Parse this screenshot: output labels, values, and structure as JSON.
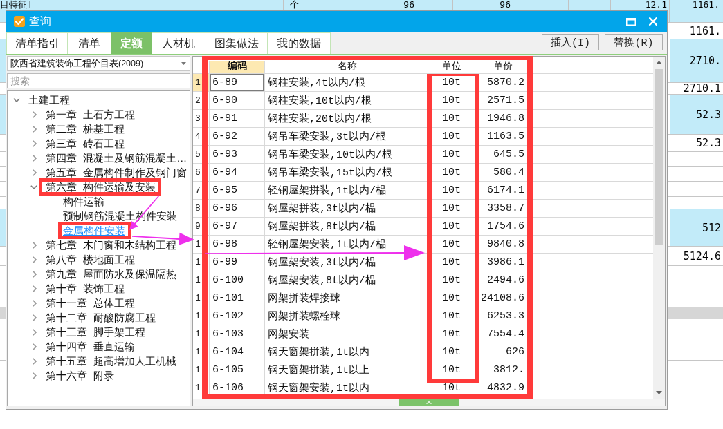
{
  "sheet": {
    "top_row": {
      "highlighted": true,
      "cells": [
        "目特征]",
        "个",
        "96",
        "96",
        "12.1",
        "1161."
      ]
    },
    "rows": [
      {
        "value": "1161.",
        "highlighted": false
      },
      {
        "value": "2710.",
        "highlighted": true
      },
      {
        "value": "2710.1",
        "highlighted": false
      },
      {
        "value": "52.3",
        "highlighted": true
      },
      {
        "value": "52.3",
        "highlighted": false
      },
      {
        "highlighted": false
      },
      {
        "highlighted": false
      },
      {
        "highlighted": false
      },
      {
        "highlighted": false
      },
      {
        "value": "512",
        "highlighted": true
      },
      {
        "value": "5124.6",
        "highlighted": false
      },
      {
        "highlighted": false
      }
    ]
  },
  "window": {
    "title": "查询",
    "tabs": [
      {
        "label": "清单指引",
        "selected": false
      },
      {
        "label": "清单",
        "selected": false
      },
      {
        "label": "定额",
        "selected": true
      },
      {
        "label": "人材机",
        "selected": false
      },
      {
        "label": "图集做法",
        "selected": false
      },
      {
        "label": "我的数据",
        "selected": false
      }
    ],
    "buttons": [
      "插入(I)",
      "替换(R)"
    ]
  },
  "catalog": {
    "dropdown": "陕西省建筑装饰工程价目表(2009)",
    "search": {
      "placeholder": "搜索"
    },
    "tree": [
      {
        "label": "土建工程",
        "expanded": true,
        "selected": false,
        "children": [
          {
            "label": "第一章 土石方工程",
            "expanded": false,
            "selected": false
          },
          {
            "label": "第二章 桩基工程",
            "expanded": false,
            "selected": false
          },
          {
            "label": "第三章 砖石工程",
            "expanded": false,
            "selected": false
          },
          {
            "label": "第四章 混凝土及钢筋混凝土…",
            "expanded": false,
            "selected": false
          },
          {
            "label": "第五章 金属构件制作及钢门窗",
            "expanded": false,
            "selected": false
          },
          {
            "label": "第六章 构件运输及安装",
            "expanded": true,
            "selected": false,
            "children": [
              {
                "label": "构件运输",
                "selected": false
              },
              {
                "label": "预制钢筋混凝土构件安装",
                "selected": false
              },
              {
                "label": "金属构件安装",
                "selected": true
              }
            ]
          },
          {
            "label": "第七章 木门窗和木结构工程",
            "expanded": false,
            "selected": false
          },
          {
            "label": "第八章 楼地面工程",
            "expanded": false,
            "selected": false
          },
          {
            "label": "第九章 屋面防水及保温隔热",
            "expanded": false,
            "selected": false
          },
          {
            "label": "第十章 装饰工程",
            "expanded": false,
            "selected": false
          },
          {
            "label": "第十一章 总体工程",
            "expanded": false,
            "selected": false
          },
          {
            "label": "第十二章 耐酸防腐工程",
            "expanded": false,
            "selected": false
          },
          {
            "label": "第十三章 脚手架工程",
            "expanded": false,
            "selected": false
          },
          {
            "label": "第十四章 垂直运输",
            "expanded": false,
            "selected": false
          },
          {
            "label": "第十五章 超高增加人工机械",
            "expanded": false,
            "selected": false
          },
          {
            "label": "第十六章 附录",
            "expanded": false,
            "selected": false
          }
        ]
      }
    ]
  },
  "table": {
    "columns": [
      {
        "label": "编码",
        "selected": true
      },
      {
        "label": "名称",
        "selected": false
      },
      {
        "label": "单位",
        "selected": false
      },
      {
        "label": "单价",
        "selected": false
      }
    ],
    "rows": [
      {
        "number": "1",
        "code": "6-89",
        "name": "钢柱安装,4t以内/根",
        "unit": "10t",
        "price": "5870.2",
        "selected": true
      },
      {
        "number": "2",
        "code": "6-90",
        "name": "钢柱安装,10t以内/根",
        "unit": "10t",
        "price": "2571.5",
        "selected": false
      },
      {
        "number": "3",
        "code": "6-91",
        "name": "钢柱安装,20t以内/根",
        "unit": "10t",
        "price": "1946.8",
        "selected": false
      },
      {
        "number": "4",
        "code": "6-92",
        "name": "钢吊车梁安装,3t以内/根",
        "unit": "10t",
        "price": "1163.5",
        "selected": false
      },
      {
        "number": "5",
        "code": "6-93",
        "name": "钢吊车梁安装,10t以内/根",
        "unit": "10t",
        "price": "645.5",
        "selected": false
      },
      {
        "number": "6",
        "code": "6-94",
        "name": "钢吊车梁安装,15t以内/根",
        "unit": "10t",
        "price": "580.4",
        "selected": false
      },
      {
        "number": "7",
        "code": "6-95",
        "name": "轻钢屋架拼装,1t以内/榀",
        "unit": "10t",
        "price": "6174.1",
        "selected": false
      },
      {
        "number": "8",
        "code": "6-96",
        "name": "钢屋架拼装,3t以内/榀",
        "unit": "10t",
        "price": "3358.7",
        "selected": false
      },
      {
        "number": "9",
        "code": "6-97",
        "name": "钢屋架拼装,8t以内/榀",
        "unit": "10t",
        "price": "1754.6",
        "selected": false
      },
      {
        "number": "1",
        "code": "6-98",
        "name": "轻钢屋架安装,1t以内/榀",
        "unit": "10t",
        "price": "9840.8",
        "selected": false
      },
      {
        "number": "1",
        "code": "6-99",
        "name": "钢屋架安装,3t以内/榀",
        "unit": "10t",
        "price": "3986.1",
        "selected": false
      },
      {
        "number": "1",
        "code": "6-100",
        "name": "钢屋架安装,8t以内/榀",
        "unit": "10t",
        "price": "2494.6",
        "selected": false
      },
      {
        "number": "1",
        "code": "6-101",
        "name": "网架拼装焊接球",
        "unit": "10t",
        "price": "24108.6",
        "selected": false
      },
      {
        "number": "1",
        "code": "6-102",
        "name": "网架拼装螺栓球",
        "unit": "10t",
        "price": "6253.3",
        "selected": false
      },
      {
        "number": "1",
        "code": "6-103",
        "name": "网架安装",
        "unit": "10t",
        "price": "7554.4",
        "selected": false
      },
      {
        "number": "1",
        "code": "6-104",
        "name": "钢天窗架拼装,1t以内",
        "unit": "10t",
        "price": "626",
        "selected": false
      },
      {
        "number": "1",
        "code": "6-105",
        "name": "钢天窗架拼装,1t以上",
        "unit": "10t",
        "price": "3812.",
        "selected": false
      },
      {
        "number": "1",
        "code": "6-106",
        "name": "钢天窗架安装,1t以内",
        "unit": "10t",
        "price": "4832.9",
        "selected": false
      }
    ]
  }
}
